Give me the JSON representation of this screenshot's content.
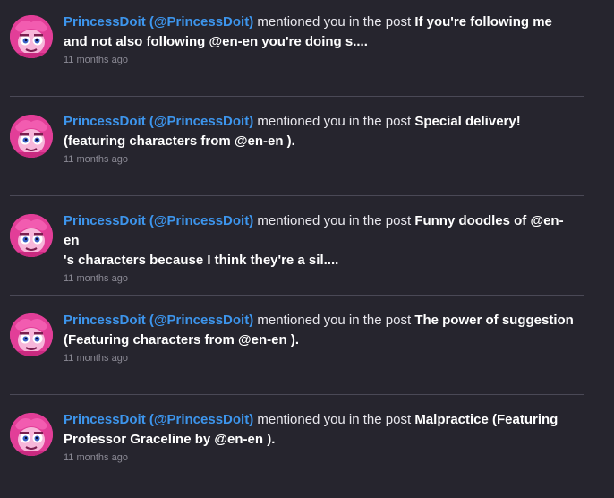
{
  "notifications": [
    {
      "user": "PrincessDoit (@PrincessDoit)",
      "action": " mentioned you in the post ",
      "post_line1": "If you're following me",
      "post_line2": "and not also following @en-en you're doing s....",
      "time": "11 months ago"
    },
    {
      "user": "PrincessDoit (@PrincessDoit)",
      "action": " mentioned you in the post ",
      "post_line1": "Special delivery!",
      "post_line2": "(featuring characters from @en-en ).",
      "time": "11 months ago"
    },
    {
      "user": "PrincessDoit (@PrincessDoit)",
      "action": " mentioned you in the post ",
      "post_line1": "Funny doodles of @en-en",
      "post_line2": "'s characters because I think they're a sil....",
      "time": "11 months ago"
    },
    {
      "user": "PrincessDoit (@PrincessDoit)",
      "action": " mentioned you in the post ",
      "post_line1": "The power of suggestion",
      "post_line2": "(Featuring characters from @en-en ).",
      "time": "11 months ago"
    },
    {
      "user": "PrincessDoit (@PrincessDoit)",
      "action": " mentioned you in the post ",
      "post_line1": "Malpractice (Featuring",
      "post_line2": "Professor Graceline by @en-en ).",
      "time": "11 months ago"
    }
  ],
  "colors": {
    "background": "#26252e",
    "username": "#3d95ec",
    "post_title": "#ffffff",
    "timestamp": "#8b8a95",
    "avatar_pink": "#e23e98"
  },
  "avatar_icon": "princess-avatar"
}
